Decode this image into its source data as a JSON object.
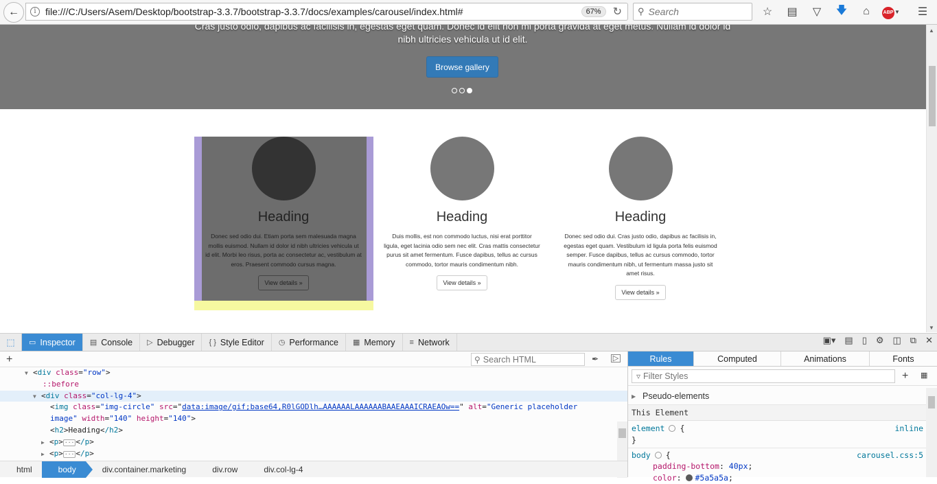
{
  "browser": {
    "url": "file:///C:/Users/Asem/Desktop/bootstrap-3.3.7/bootstrap-3.3.7/docs/examples/carousel/index.html#",
    "zoom": "67%",
    "search_placeholder": "Search",
    "abp_label": "ABP"
  },
  "page": {
    "carousel": {
      "caption": "Cras justo odio, dapibus ac facilisis in, egestas eget quam. Donec id elit non mi porta gravida at eget metus. Nullam id dolor id nibh ultricies vehicula ut id elit.",
      "button_label": "Browse gallery",
      "indicators": 3,
      "active_indicator": 3
    },
    "columns": [
      {
        "heading": "Heading",
        "text": "Donec sed odio dui. Etiam porta sem malesuada magna mollis euismod. Nullam id dolor id nibh ultricies vehicula ut id elit. Morbi leo risus, porta ac consectetur ac, vestibulum at eros. Praesent commodo cursus magna.",
        "button": "View details »"
      },
      {
        "heading": "Heading",
        "text": "Duis mollis, est non commodo luctus, nisi erat porttitor ligula, eget lacinia odio sem nec elit. Cras mattis consectetur purus sit amet fermentum. Fusce dapibus, tellus ac cursus commodo, tortor mauris condimentum nibh.",
        "button": "View details »"
      },
      {
        "heading": "Heading",
        "text": "Donec sed odio dui. Cras justo odio, dapibus ac facilisis in, egestas eget quam. Vestibulum id ligula porta felis euismod semper. Fusce dapibus, tellus ac cursus commodo, tortor mauris condimentum nibh, ut fermentum massa justo sit amet risus.",
        "button": "View details »"
      }
    ]
  },
  "devtools": {
    "tabs": [
      "Inspector",
      "Console",
      "Debugger",
      "Style Editor",
      "Performance",
      "Memory",
      "Network"
    ],
    "active_tab": "Inspector",
    "search_html_placeholder": "Search HTML",
    "markup": {
      "l1_tag": "div",
      "l1_attr": "class",
      "l1_val": "\"row\"",
      "l2_pseudo": "::before",
      "l3_tag": "div",
      "l3_attr": "class",
      "l3_val": "\"col-lg-4\"",
      "l4_tag": "img",
      "l4_attr1": "class",
      "l4_val1": "\"img-circle\"",
      "l4_attr2": "src",
      "l4_src": "data:image/gif;base64,R0lGODlh…AAAAAALAAAAAABAAEAAAICRAEAOw==",
      "l4_attr3": "alt",
      "l4_val3a": "\"Generic placeholder",
      "l5_val3b": "image\"",
      "l5_attr4": "width",
      "l5_val4": "\"140\"",
      "l5_attr5": "height",
      "l5_val5": "\"140\"",
      "l6_open": "h2",
      "l6_text": "Heading",
      "l6_close": "/h2",
      "l7_tag": "p",
      "l7_close": "/p",
      "l8_tag": "p",
      "l8_close": "/p"
    },
    "breadcrumbs": [
      "html",
      "body",
      "div.container.marketing",
      "div.row",
      "div.col-lg-4"
    ],
    "active_breadcrumb": "body",
    "side_tabs": [
      "Rules",
      "Computed",
      "Animations",
      "Fonts"
    ],
    "active_side_tab": "Rules",
    "filter_placeholder": "Filter Styles",
    "pseudo_elements_label": "Pseudo-elements",
    "this_element_label": "This Element",
    "rules": {
      "r1_selector": "element",
      "r1_open": "{",
      "r1_close": "}",
      "r1_source": "inline",
      "r2_selector": "body",
      "r2_open": "{",
      "r2_source": "carousel.css:5",
      "r2_prop1": "padding-bottom",
      "r2_val1": "40px",
      "r2_prop2": "color",
      "r2_val2": "#5a5a5a",
      "r2_color": "#5a5a5a"
    }
  },
  "colors": {
    "accent": "#3a8bd3",
    "primary_button": "#337ab7",
    "highlight_content": "#6d6d6d",
    "highlight_padding": "#a99bd6",
    "highlight_margin": "#f6f8a0"
  }
}
